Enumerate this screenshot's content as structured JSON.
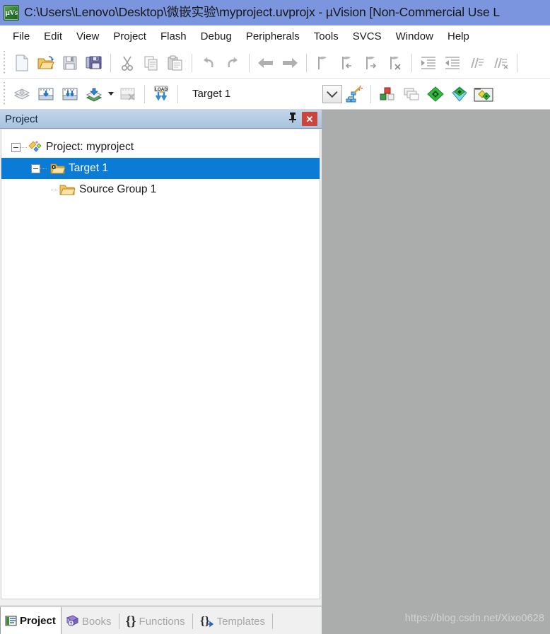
{
  "window": {
    "title": "C:\\Users\\Lenovo\\Desktop\\微嵌实验\\myproject.uvprojx - µVision  [Non-Commercial Use L",
    "app_icon": "uvision-icon",
    "app_icon_text": "µVs"
  },
  "menubar": {
    "items": [
      {
        "label": "File"
      },
      {
        "label": "Edit"
      },
      {
        "label": "View"
      },
      {
        "label": "Project"
      },
      {
        "label": "Flash"
      },
      {
        "label": "Debug"
      },
      {
        "label": "Peripherals"
      },
      {
        "label": "Tools"
      },
      {
        "label": "SVCS"
      },
      {
        "label": "Window"
      },
      {
        "label": "Help"
      }
    ]
  },
  "toolbar_file": {
    "buttons": [
      {
        "name": "new-file-icon",
        "tip": "New"
      },
      {
        "name": "open-file-icon",
        "tip": "Open"
      },
      {
        "name": "save-icon",
        "tip": "Save"
      },
      {
        "name": "save-all-icon",
        "tip": "Save All"
      },
      {
        "name": "cut-icon",
        "tip": "Cut"
      },
      {
        "name": "copy-icon",
        "tip": "Copy"
      },
      {
        "name": "paste-icon",
        "tip": "Paste"
      },
      {
        "name": "undo-icon",
        "tip": "Undo"
      },
      {
        "name": "redo-icon",
        "tip": "Redo"
      },
      {
        "name": "navigate-back-icon",
        "tip": "Back"
      },
      {
        "name": "navigate-forward-icon",
        "tip": "Forward"
      },
      {
        "name": "bookmark-toggle-icon",
        "tip": "Insert/Remove Bookmark"
      },
      {
        "name": "bookmark-prev-icon",
        "tip": "Previous Bookmark"
      },
      {
        "name": "bookmark-next-icon",
        "tip": "Next Bookmark"
      },
      {
        "name": "bookmark-clear-icon",
        "tip": "Clear All Bookmarks"
      },
      {
        "name": "indent-icon",
        "tip": "Indent Selected Text"
      },
      {
        "name": "outdent-icon",
        "tip": "Outdent Selected Text"
      },
      {
        "name": "comment-icon",
        "tip": "Comment Selection"
      },
      {
        "name": "uncomment-icon",
        "tip": "Uncomment Selection"
      }
    ]
  },
  "toolbar_build": {
    "buttons": [
      {
        "name": "translate-icon",
        "tip": "Translate"
      },
      {
        "name": "build-icon",
        "tip": "Build"
      },
      {
        "name": "rebuild-icon",
        "tip": "Rebuild"
      },
      {
        "name": "batch-build-icon",
        "tip": "Batch Build"
      },
      {
        "name": "stop-build-icon",
        "tip": "Stop Build"
      },
      {
        "name": "download-icon",
        "tip": "Download"
      },
      {
        "name": "manage-project-items-icon",
        "tip": "Manage Project Items"
      },
      {
        "name": "multi-project-icon",
        "tip": "Manage Multi-Project"
      },
      {
        "name": "configure-target-icon",
        "tip": "Options for Target"
      },
      {
        "name": "pack-installer-icon",
        "tip": "Pack Installer"
      },
      {
        "name": "manage-run-environment-icon",
        "tip": "Manage Run-Time Environment"
      }
    ],
    "target_value": "Target 1",
    "target_dropdown_icon": "chevron-down-icon",
    "options_icon": "target-options-wand-icon"
  },
  "project_panel": {
    "caption": "Project",
    "pin_icon": "pin-icon",
    "close_icon": "close-icon",
    "tree": [
      {
        "label": "Project: myproject",
        "icon": "project-icon",
        "level": 0,
        "expanded": true,
        "selected": false
      },
      {
        "label": "Target 1",
        "icon": "target-folder-icon",
        "level": 1,
        "expanded": true,
        "selected": true
      },
      {
        "label": "Source Group 1",
        "icon": "folder-icon",
        "level": 2,
        "expanded": false,
        "selected": false
      }
    ]
  },
  "bottom_tabs": [
    {
      "label": "Project",
      "icon": "project-tab-icon",
      "active": true
    },
    {
      "label": "Books",
      "icon": "books-icon",
      "active": false
    },
    {
      "label": "Functions",
      "icon": "functions-braces-icon",
      "active": false
    },
    {
      "label": "Templates",
      "icon": "templates-icon",
      "active": false
    }
  ],
  "watermark": {
    "text": "https://blog.csdn.net/Xixo0628"
  },
  "colors": {
    "titlebar": "#7b96df",
    "mdi_background": "#abadad",
    "selection": "#0a7cd6",
    "dock_caption": "#a9c3de",
    "close_button": "#c9453e"
  }
}
